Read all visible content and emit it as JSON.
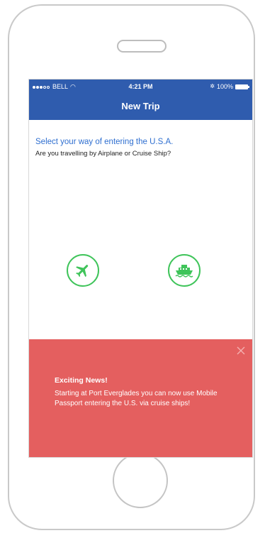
{
  "status_bar": {
    "carrier": "BELL",
    "time": "4:21 PM",
    "battery": "100%"
  },
  "navbar": {
    "title": "New Trip"
  },
  "prompt": {
    "heading": "Select your way of entering the U.S.A.",
    "question": "Are you travelling by Airplane or Cruise Ship?"
  },
  "options": [
    {
      "icon": "airplane-icon",
      "color": "#3fc45a"
    },
    {
      "icon": "ship-icon",
      "color": "#3fc45a"
    }
  ],
  "banner": {
    "title": "Exciting News!",
    "body": "Starting at Port Everglades you can now use Mobile Passport entering the U.S. via cruise ships!",
    "color": "#e45f5f"
  },
  "colors": {
    "navbar": "#2f5cae",
    "heading": "#2f6fd0",
    "accent": "#3fc45a"
  }
}
